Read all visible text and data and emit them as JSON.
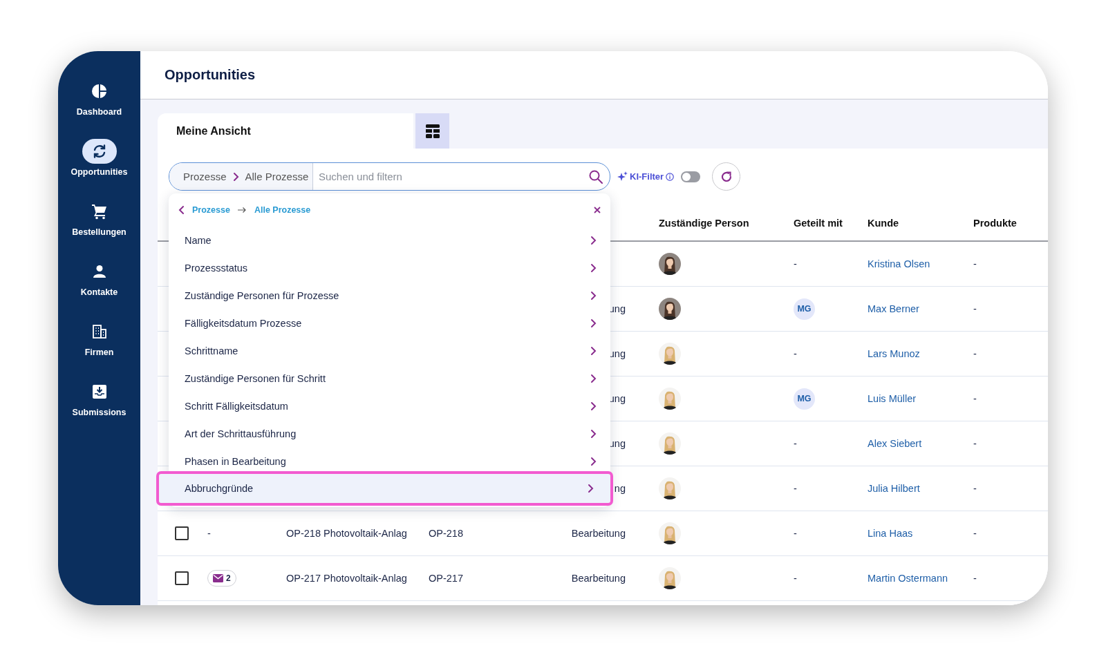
{
  "sidebar": {
    "items": [
      {
        "label": "Dashboard",
        "selected": false
      },
      {
        "label": "Opportunities",
        "selected": true
      },
      {
        "label": "Bestellungen",
        "selected": false
      },
      {
        "label": "Kontakte",
        "selected": false
      },
      {
        "label": "Firmen",
        "selected": false
      },
      {
        "label": "Submissions",
        "selected": false
      }
    ]
  },
  "header": {
    "title": "Opportunities"
  },
  "views": {
    "tabs": [
      {
        "label": "Meine Ansicht",
        "selected": true
      }
    ]
  },
  "search": {
    "path": [
      "Prozesse",
      "Alle Prozesse"
    ],
    "placeholder": "Suchen und filtern"
  },
  "ai_filter": {
    "label": "KI-Filter",
    "on": false
  },
  "dropdown": {
    "breadcrumb": [
      "Prozesse",
      "Alle Prozesse"
    ],
    "items": [
      {
        "label": "Name",
        "highlighted": false
      },
      {
        "label": "Prozessstatus",
        "highlighted": false
      },
      {
        "label": "Zuständige Personen für Prozesse",
        "highlighted": false
      },
      {
        "label": "Fälligkeitsdatum Prozesse",
        "highlighted": false
      },
      {
        "label": "Schrittname",
        "highlighted": false
      },
      {
        "label": "Zuständige Personen für Schritt",
        "highlighted": false
      },
      {
        "label": "Schritt Fälligkeitsdatum",
        "highlighted": false
      },
      {
        "label": "Art der Schrittausführung",
        "highlighted": false
      },
      {
        "label": "Phasen in Bearbeitung",
        "highlighted": false
      },
      {
        "label": "Abbruchgründe",
        "highlighted": true
      }
    ]
  },
  "table": {
    "visible_columns": [
      "Zuständige Person",
      "Geteilt mit",
      "Kunde",
      "Produkte"
    ],
    "rows": [
      {
        "shared": {
          "kind": "dash",
          "text": "-"
        },
        "customer": "Kristina Olsen",
        "products": "-"
      },
      {
        "status": "ung",
        "shared": {
          "kind": "initials",
          "text": "MG"
        },
        "customer": "Max Berner",
        "products": "-"
      },
      {
        "status": "ung",
        "shared": {
          "kind": "dash",
          "text": "-"
        },
        "customer": "Lars Munoz",
        "products": "-"
      },
      {
        "status": "ung",
        "shared": {
          "kind": "initials",
          "text": "MG"
        },
        "customer": "Luis Müller",
        "products": "-"
      },
      {
        "status": "ung",
        "shared": {
          "kind": "dash",
          "text": "-"
        },
        "customer": "Alex Siebert",
        "products": "-"
      },
      {
        "status": "ng",
        "shared": {
          "kind": "dash",
          "text": "-"
        },
        "customer": "Julia Hilbert",
        "products": "-"
      },
      {
        "checked": false,
        "badge": {
          "kind": "dash",
          "text": "-"
        },
        "name": "OP-218 Photovoltaik-Anlag",
        "id": "OP-218",
        "status": "Bearbeitung",
        "shared": {
          "kind": "dash",
          "text": "-"
        },
        "customer": "Lina Haas",
        "products": "-"
      },
      {
        "checked": false,
        "badge": {
          "kind": "mail",
          "text": "2"
        },
        "name": "OP-217 Photovoltaik-Anlag",
        "id": "OP-217",
        "status": "Bearbeitung",
        "shared": {
          "kind": "dash",
          "text": "-"
        },
        "customer": "Martin Ostermann",
        "products": "-"
      }
    ]
  }
}
